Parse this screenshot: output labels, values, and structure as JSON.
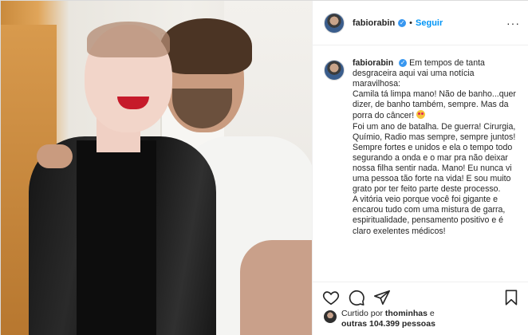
{
  "header": {
    "username": "fabiorabin",
    "separator": "•",
    "follow_label": "Seguir",
    "more_label": "···"
  },
  "caption": {
    "username": "fabiorabin",
    "p1": "Em tempos de tanta desgraceira aqui vai uma notícia maravilhosa:",
    "p2": "Camila tá limpa mano! Não de banho...quer dizer, de banho também, sempre. Mas da porra do câncer! ",
    "p3": "Foi um ano de batalha. De guerra! Cirurgia, Químio, Radio mas sempre, sempre juntos! Sempre fortes e unidos e ela o tempo todo segurando a onda e o mar pra não deixar nossa filha sentir nada. Mano! Eu nunca vi uma pessoa tão forte na vida! E sou muito grato por ter feito parte deste processo.",
    "p4": "A vitória veio porque você foi gigante e encarou tudo com uma mistura de garra, espiritualidade, pensamento positivo e é claro exelentes médicos!"
  },
  "likes": {
    "prefix": "Curtido por",
    "user": "thominhas",
    "middle": "e",
    "others": "outras 104.399 pessoas"
  },
  "icons": [
    "heart-icon",
    "comment-icon",
    "share-icon",
    "bookmark-icon",
    "verified-icon",
    "emoji-heart-eyes-icon"
  ]
}
